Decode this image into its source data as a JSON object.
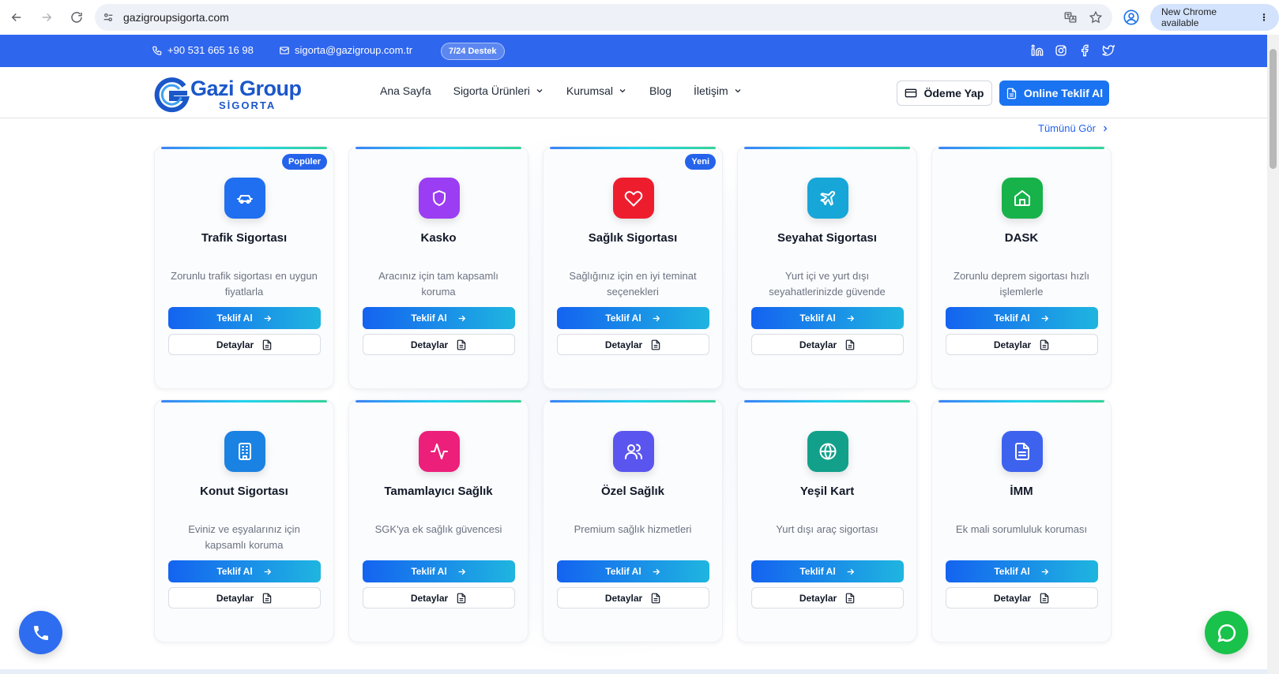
{
  "browser": {
    "url": "gazigroupsigorta.com",
    "update_label": "New Chrome available"
  },
  "topbar": {
    "phone": "+90 531 665 16 98",
    "email": "sigorta@gazigroup.com.tr",
    "support": "7/24 Destek"
  },
  "header": {
    "logo_line1": "Gazi Group",
    "logo_line2": "SİGORTA",
    "menu": [
      {
        "label": "Ana Sayfa"
      },
      {
        "label": "Sigorta Ürünleri"
      },
      {
        "label": "Kurumsal"
      },
      {
        "label": "Blog"
      },
      {
        "label": "İletişim"
      }
    ],
    "pay_label": "Ödeme Yap",
    "offer_label": "Online Teklif Al"
  },
  "main": {
    "see_all": "Tümünü Gör",
    "teklif_label": "Teklif Al",
    "detay_label": "Detaylar",
    "cards": [
      {
        "title": "Trafik Sigortası",
        "desc": "Zorunlu trafik sigortası en uygun fiyatlarla",
        "badge": "Popüler",
        "icon": "car-icon",
        "color": "#1f6ff0"
      },
      {
        "title": "Kasko",
        "desc": "Aracınız için tam kapsamlı koruma",
        "badge": "",
        "icon": "shield-icon",
        "color": "#9b3df2"
      },
      {
        "title": "Sağlık Sigortası",
        "desc": "Sağlığınız için en iyi teminat seçenekleri",
        "badge": "Yeni",
        "icon": "heart-icon",
        "color": "#ee1d2e"
      },
      {
        "title": "Seyahat Sigortası",
        "desc": "Yurt içi ve yurt dışı seyahatlerinizde güvende",
        "badge": "",
        "icon": "plane-icon",
        "color": "#16a6d8"
      },
      {
        "title": "DASK",
        "desc": "Zorunlu deprem sigortası hızlı işlemlerle",
        "badge": "",
        "icon": "home-icon",
        "color": "#17b24a"
      },
      {
        "title": "Konut Sigortası",
        "desc": "Eviniz ve eşyalarınız için kapsamlı koruma",
        "badge": "",
        "icon": "building-icon",
        "color": "#1a82e2"
      },
      {
        "title": "Tamamlayıcı Sağlık",
        "desc": "SGK'ya ek sağlık güvencesi",
        "badge": "",
        "icon": "activity-icon",
        "color": "#ec1f7a"
      },
      {
        "title": "Özel Sağlık",
        "desc": "Premium sağlık hizmetleri",
        "badge": "",
        "icon": "users-icon",
        "color": "#5b55ef"
      },
      {
        "title": "Yeşil Kart",
        "desc": "Yurt dışı araç sigortası",
        "badge": "",
        "icon": "globe-icon",
        "color": "#12a08a"
      },
      {
        "title": "İMM",
        "desc": "Ek mali sorumluluk koruması",
        "badge": "",
        "icon": "document-icon",
        "color": "#3d63ee"
      }
    ]
  }
}
